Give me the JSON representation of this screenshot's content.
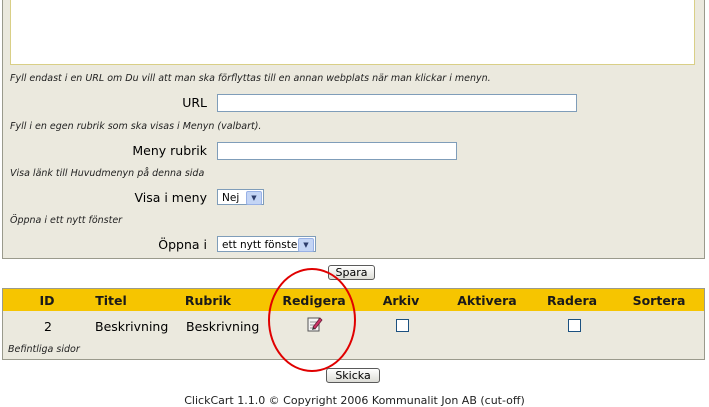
{
  "form": {
    "url_hint": "Fyll endast i en URL om Du vill att man ska förflyttas till en annan webplats när man klickar i menyn.",
    "url_label": "URL",
    "url_value": "",
    "menu_title_hint": "Fyll i en egen rubrik som ska visas i Menyn (valbart).",
    "menu_title_label": "Meny rubrik",
    "menu_title_value": "",
    "show_in_menu_hint": "Visa länk till Huvudmenyn på denna sida",
    "show_in_menu_label": "Visa i meny",
    "show_in_menu_value": "Nej",
    "open_in_hint": "Öppna i ett nytt fönster",
    "open_in_label": "Öppna i",
    "open_in_value": "ett nytt fönster",
    "save_label": "Spara"
  },
  "table": {
    "headers": [
      "ID",
      "Titel",
      "Rubrik",
      "Redigera",
      "Arkiv",
      "Aktivera",
      "Radera",
      "Sortera"
    ],
    "rows": [
      {
        "id": "2",
        "title": "Beskrivning",
        "heading": "Beskrivning",
        "archived": false,
        "delete": false
      }
    ],
    "caption": "Befintliga sidor"
  },
  "send_label": "Skicka",
  "footer": "ClickCart 1.1.0 © Copyright 2006  Kommunalit Jon AB (cut-off)",
  "colors": {
    "header_bg": "#f6c500",
    "panel_bg": "#ebe9de",
    "annotation": "#e00000"
  }
}
